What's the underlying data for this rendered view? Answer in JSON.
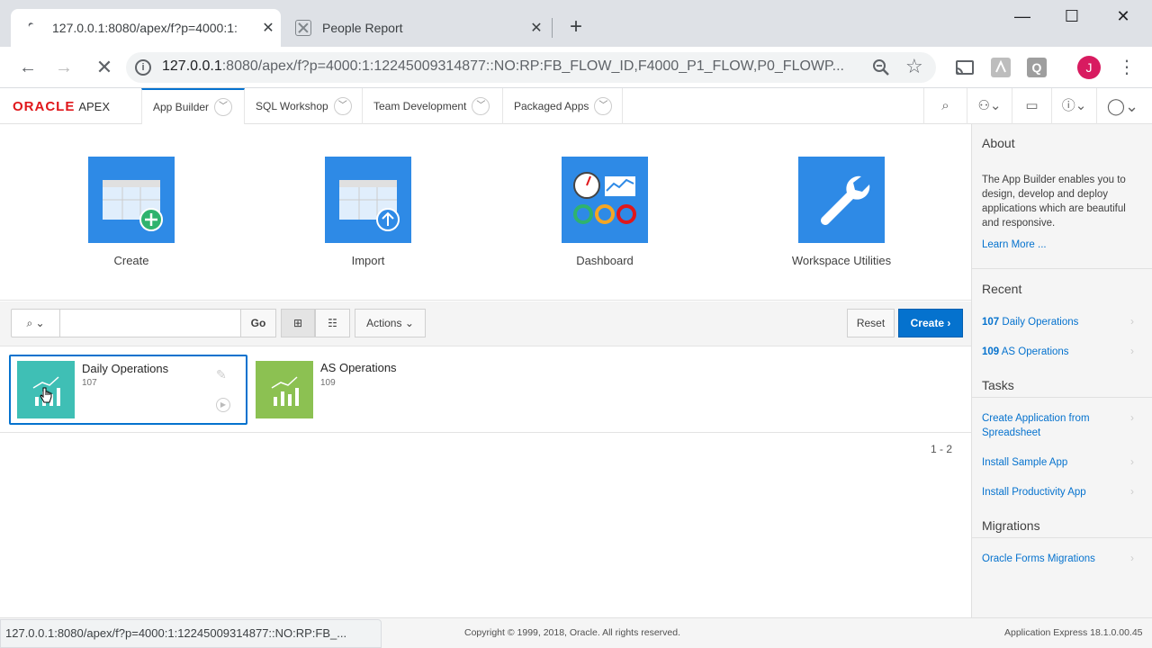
{
  "browser": {
    "tabs": [
      {
        "title": "127.0.0.1:8080/apex/f?p=4000:1:",
        "active": true
      },
      {
        "title": "People Report",
        "active": false
      }
    ],
    "url_host": "127.0.0.1",
    "url_rest": ":8080/apex/f?p=4000:1:12245009314877::NO:RP:FB_FLOW_ID,F4000_P1_FLOW,P0_FLOWP...",
    "profile_initial": "J",
    "status_url": "127.0.0.1:8080/apex/f?p=4000:1:12245009314877::NO:RP:FB_..."
  },
  "apex": {
    "logo_text": "ORACLE",
    "logo_sub": "APEX",
    "menus": [
      "App Builder",
      "SQL Workshop",
      "Team Development",
      "Packaged Apps"
    ]
  },
  "tiles": [
    {
      "label": "Create",
      "icon": "create-app-icon"
    },
    {
      "label": "Import",
      "icon": "import-icon"
    },
    {
      "label": "Dashboard",
      "icon": "dashboard-icon"
    },
    {
      "label": "Workspace Utilities",
      "icon": "wrench-icon"
    }
  ],
  "toolbar": {
    "search_value": "",
    "go_label": "Go",
    "actions_label": "Actions",
    "reset_label": "Reset",
    "create_label": "Create"
  },
  "apps": [
    {
      "name": "Daily Operations",
      "id": "107",
      "color": "#3fbfb5"
    },
    {
      "name": "AS Operations",
      "id": "109",
      "color": "#8cc152"
    }
  ],
  "pagination": "1 - 2",
  "side": {
    "about_heading": "About",
    "about_text": "The App Builder enables you to design, develop and deploy applications which are beautiful and responsive.",
    "learn_more": "Learn More ...",
    "recent_heading": "Recent",
    "recent": [
      {
        "id": "107",
        "name": "Daily Operations"
      },
      {
        "id": "109",
        "name": "AS Operations"
      }
    ],
    "tasks_heading": "Tasks",
    "tasks": [
      "Create Application from Spreadsheet",
      "Install Sample App",
      "Install Productivity App"
    ],
    "migrations_heading": "Migrations",
    "migrations": [
      "Oracle Forms Migrations"
    ]
  },
  "footer": {
    "copyright": "Copyright © 1999, 2018, Oracle. All rights reserved.",
    "version": "Application Express 18.1.0.00.45"
  },
  "colors": {
    "accent": "#0572ce",
    "tile_blue": "#2e8ae6",
    "oracle_red": "#e0171b"
  }
}
